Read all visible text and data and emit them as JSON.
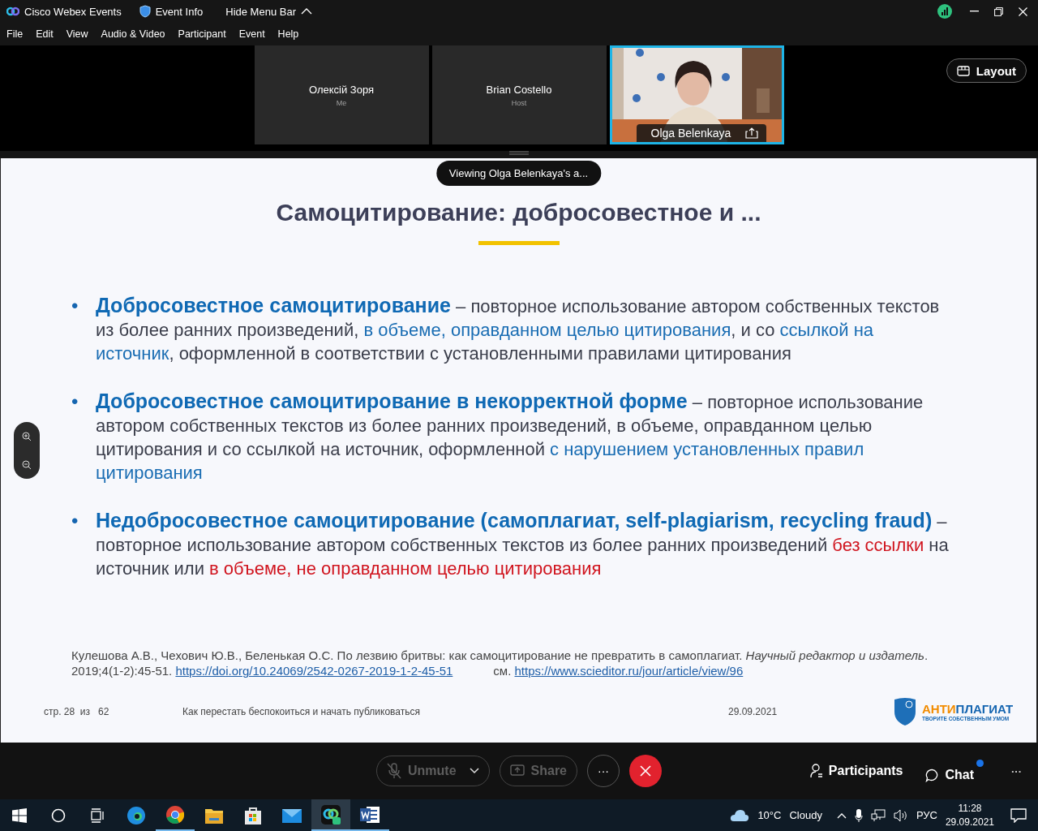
{
  "title_bar": {
    "app_name": "Cisco Webex Events",
    "event_info": "Event Info",
    "hide_menu": "Hide Menu Bar"
  },
  "menu": [
    "File",
    "Edit",
    "View",
    "Audio & Video",
    "Participant",
    "Event",
    "Help"
  ],
  "participants": [
    {
      "kind": "avatar",
      "name": "Олексій Зоря",
      "role": "Me",
      "selected": false
    },
    {
      "kind": "avatar",
      "name": "Brian Costello",
      "role": "Host",
      "selected": false
    },
    {
      "kind": "video",
      "name": "Olga Belenkaya",
      "selected": true
    }
  ],
  "layout_button": "Layout",
  "slide": {
    "viewing_banner": "Viewing Olga Belenkaya's a...",
    "title": "Самоцитирование: добросовестное и ...",
    "bullets": [
      {
        "marker": "•",
        "segments": [
          {
            "kind": "term",
            "text": "Добросовестное самоцитирование"
          },
          {
            "kind": "plain",
            "text": " – повторное использование автором собственных текстов из более ранних произведений, "
          },
          {
            "kind": "highlight",
            "text": "в объеме, оправданном целью цитирования"
          },
          {
            "kind": "plain",
            "text": ", и со "
          },
          {
            "kind": "highlight",
            "text": "ссылкой на источник"
          },
          {
            "kind": "plain",
            "text": ", оформленной в соответствии с установленными правилами цитирования"
          }
        ]
      },
      {
        "marker": "•",
        "segments": [
          {
            "kind": "term",
            "text": "Добросовестное самоцитирование в некорректной форме"
          },
          {
            "kind": "plain",
            "text": " – повторное использование автором собственных текстов из более ранних произведений, в объеме, оправданном целью цитирования и со ссылкой на источник, оформленной "
          },
          {
            "kind": "highlight",
            "text": "с нарушением установленных правил цитирования"
          }
        ]
      },
      {
        "marker": "•",
        "segments": [
          {
            "kind": "term",
            "text": "Недобросовестное самоцитирование (самоплагиат, self-plagiarism, recycling fraud)"
          },
          {
            "kind": "plain",
            "text": " – повторное использование автором собственных текстов из более ранних произведений "
          },
          {
            "kind": "warning",
            "text": "без ссылки"
          },
          {
            "kind": "plain",
            "text": " на источник или "
          },
          {
            "kind": "warning",
            "text": "в объеме, не оправданном целью цитирования"
          }
        ]
      }
    ],
    "citation": [
      {
        "kind": "text",
        "text": "Кулешова А.В., Чехович Ю.В., Беленькая О.С. По лезвию бритвы: как самоцитирование не превратить в самоплагиат. *Научный редактор и издатель*. 2019;4(1-2):45-51."
      },
      {
        "kind": "link",
        "text": "https://doi.org/10.24069/2542-0267-2019-1-2-45-51"
      },
      {
        "kind": "gap",
        "text": "см."
      },
      {
        "kind": "link",
        "text": "https://www.scieditor.ru/jour/article/view/96"
      }
    ],
    "footer": {
      "page": "стр. 28  из   62",
      "title": "Как перестать беспокоиться и начать публиковаться",
      "date": "29.09.2021",
      "logo": {
        "brand": [
          {
            "kind": "accent",
            "text": "АНТИ"
          },
          {
            "kind": "main",
            "text": "ПЛАГИАТ"
          }
        ],
        "tagline": "ТВОРИТЕ СОБСТВЕННЫМ УМОМ"
      }
    }
  },
  "controls": {
    "unmute": {
      "label": "Unmute",
      "disabled": true
    },
    "share": {
      "label": "Share",
      "disabled": true
    },
    "more": "···",
    "participants": "Participants",
    "chat": {
      "label": "Chat",
      "unread": true
    },
    "overflow": "···"
  },
  "taskbar": {
    "apps": [
      {
        "kind": "edge",
        "running": false,
        "selected": false
      },
      {
        "kind": "chrome",
        "running": true,
        "selected": false
      },
      {
        "kind": "explorer",
        "running": false,
        "selected": false
      },
      {
        "kind": "store",
        "running": false,
        "selected": false
      },
      {
        "kind": "mail",
        "running": false,
        "selected": false
      },
      {
        "kind": "webex",
        "running": true,
        "selected": true
      },
      {
        "kind": "word",
        "running": true,
        "selected": false
      }
    ],
    "weather": {
      "temperature": "10°C",
      "condition": "Cloudy"
    },
    "language": "РУС",
    "time": "11:28",
    "date": "29.09.2021"
  }
}
